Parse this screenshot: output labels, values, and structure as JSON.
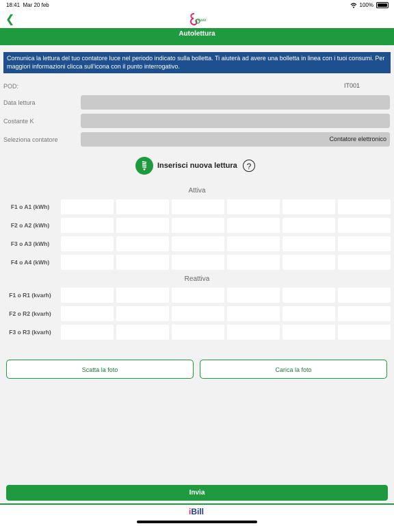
{
  "status_bar": {
    "time": "18:41",
    "date": "Mar 20 feb",
    "wifi_icon": "wifi-icon",
    "battery": "100%"
  },
  "nav": {
    "back_icon": "chevron-left-icon",
    "logo_text": "ower"
  },
  "page_title": "Autolettura",
  "info_text": "Comunica la lettura del tuo contatore luce nel periodo indicato sulla bolletta. Ti aiuterà ad avere una bolletta in linea con i tuoi consumi. Per maggiori informazioni clicca sull'icona con il punto interrogativo.",
  "form": {
    "pod_label": "POD:",
    "pod_value": "IT001",
    "data_lettura_label": "Data lettura",
    "costante_k_label": "Costante K",
    "contatore_label": "Seleziona contatore",
    "contatore_value": "Contatore elettronico"
  },
  "insert_label": "Inserisci nuova lettura",
  "help_label": "?",
  "attiva": {
    "title": "Attiva",
    "rows": [
      "F1 o A1 (kWh)",
      "F2 o A2 (kWh)",
      "F3 o A3 (kWh)",
      "F4 o A4 (kWh)"
    ]
  },
  "reattiva": {
    "title": "Reattiva",
    "rows": [
      "F1 o R1 (kvarh)",
      "F2 o R2 (kvarh)",
      "F3 o R3 (kvarh)"
    ]
  },
  "buttons": {
    "scatta": "Scatta la foto",
    "carica": "Carica la foto",
    "invia": "Invia"
  },
  "footer": {
    "brand_i": "i",
    "brand_rest": "Bill"
  },
  "colors": {
    "primary_green": "#1f9a3f",
    "info_blue": "#1e4f8f",
    "field_gray": "#cacaca"
  }
}
